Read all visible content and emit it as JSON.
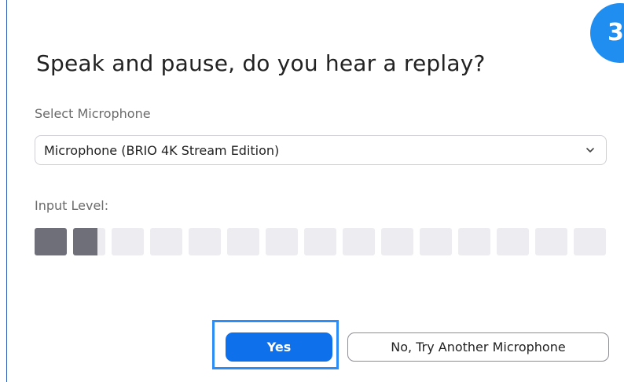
{
  "dialog": {
    "title": "Speak and pause, do you hear a replay?",
    "step_badge": "3"
  },
  "microphone": {
    "label": "Select Microphone",
    "selected": "Microphone (BRIO 4K Stream Edition)"
  },
  "input_level": {
    "label": "Input Level:",
    "total_segments": 15,
    "active_fraction": 0.11,
    "active_color": "#6f6f7a",
    "inactive_color": "#ededf1"
  },
  "buttons": {
    "yes_label": "Yes",
    "no_label": "No, Try Another Microphone"
  },
  "colors": {
    "accent": "#0e71eb",
    "highlight": "#2b8df5",
    "badge": "#1f8ef0"
  }
}
